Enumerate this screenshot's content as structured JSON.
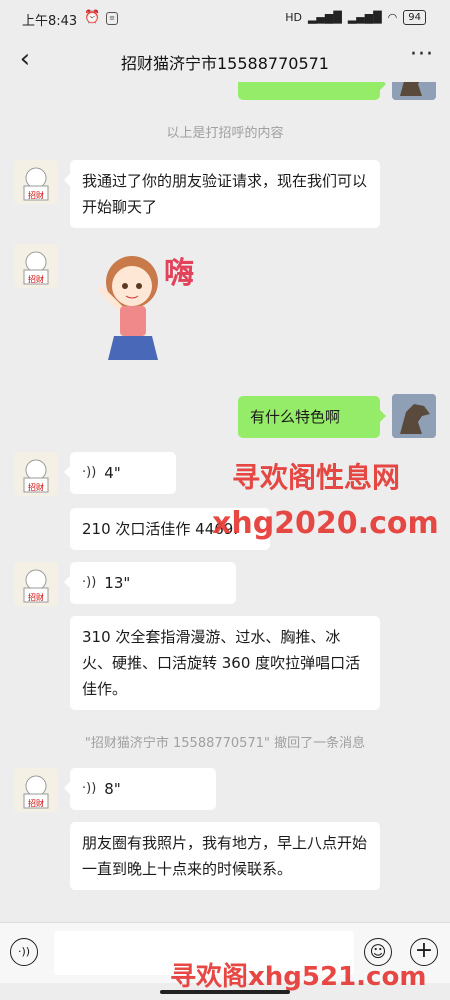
{
  "status": {
    "time": "上午8:43",
    "network": "HD",
    "battery": "94"
  },
  "header": {
    "title": "招财猫济宁市15588770571"
  },
  "messages": {
    "partial_top": "……",
    "sys_greeting": "以上是打招呼的内容",
    "msg1": "我通过了你的朋友验证请求，现在我们可以开始聊天了",
    "sticker_text": "嗨",
    "msg_me": "有什么特色啊",
    "voice1": "4\"",
    "msg2": "210 次口活佳作 4469.",
    "voice2": "13\"",
    "msg3": "310 次全套指滑漫游、过水、胸推、冰火、硬推、口活旋转 360 度吹拉弹唱口活佳作。",
    "sys_recall": "\"招财猫济宁市 15588770571\" 撤回了一条消息",
    "voice3": "8\"",
    "msg4": "朋友圈有我照片，我有地方，早上八点开始一直到晚上十点来的时候联系。"
  },
  "watermarks": {
    "wm1": "寻欢阁性息网",
    "wm2": "xhg2020.com",
    "wm3": "寻欢阁xhg521.com"
  },
  "input": {
    "placeholder": ""
  },
  "icons": [
    "back-icon",
    "more-icon",
    "voice-icon",
    "emoji-icon",
    "plus-icon"
  ]
}
